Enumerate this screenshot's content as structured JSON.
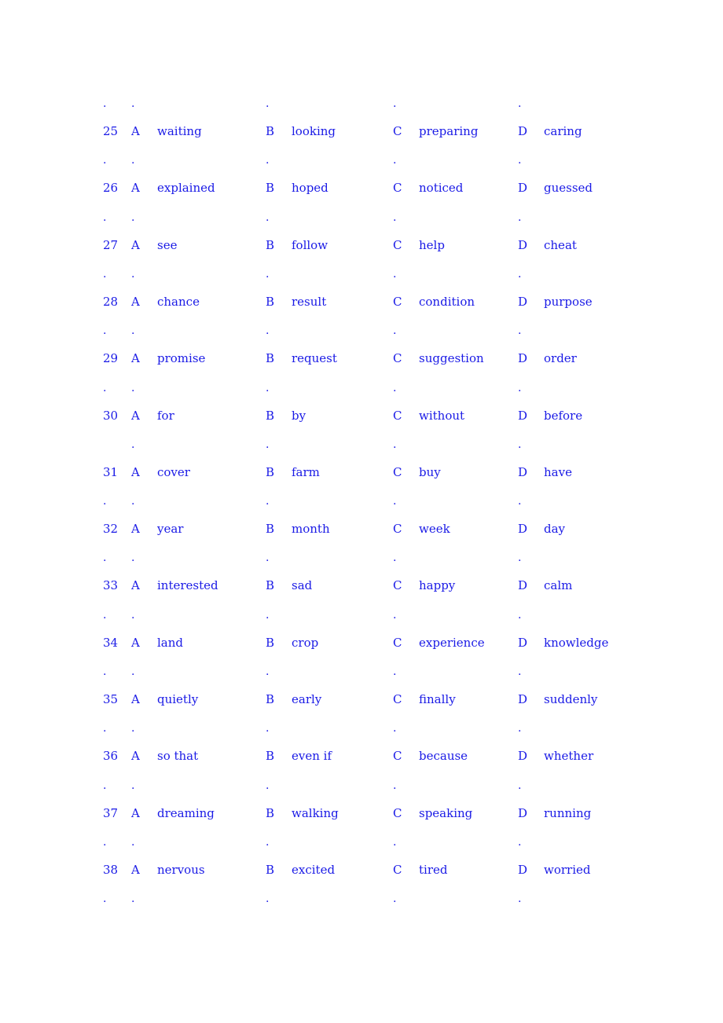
{
  "color": "#1a1ae6",
  "dot": ".",
  "questions": [
    {
      "num": "25",
      "A": "waiting",
      "B": "looking",
      "C": "preparing",
      "D": "caring",
      "leading_dot": true
    },
    {
      "num": "26",
      "A": "explained",
      "B": "hoped",
      "C": "noticed",
      "D": "guessed",
      "leading_dot": true
    },
    {
      "num": "27",
      "A": "see",
      "B": "follow",
      "C": "help",
      "D": "cheat",
      "leading_dot": true
    },
    {
      "num": "28",
      "A": "chance",
      "B": "result",
      "C": "condition",
      "D": "purpose",
      "leading_dot": true
    },
    {
      "num": "29",
      "A": "promise",
      "B": "request",
      "C": "suggestion",
      "D": "order",
      "leading_dot": true
    },
    {
      "num": "30",
      "A": "for",
      "B": "by",
      "C": "without",
      "D": "before",
      "leading_dot": true
    },
    {
      "num": "31",
      "A": "cover",
      "B": "farm",
      "C": "buy",
      "D": "have",
      "leading_dot": false
    },
    {
      "num": "32",
      "A": "year",
      "B": "month",
      "C": "week",
      "D": "day",
      "leading_dot": true
    },
    {
      "num": "33",
      "A": "interested",
      "B": "sad",
      "C": "happy",
      "D": "calm",
      "leading_dot": true
    },
    {
      "num": "34",
      "A": "land",
      "B": "crop",
      "C": "experience",
      "D": "knowledge",
      "leading_dot": true
    },
    {
      "num": "35",
      "A": "quietly",
      "B": "early",
      "C": "finally",
      "D": "suddenly",
      "leading_dot": true
    },
    {
      "num": "36",
      "A": "so that",
      "B": "even if",
      "C": "because",
      "D": "whether",
      "leading_dot": true
    },
    {
      "num": "37",
      "A": "dreaming",
      "B": "walking",
      "C": "speaking",
      "D": "running",
      "leading_dot": true
    },
    {
      "num": "38",
      "A": "nervous",
      "B": "excited",
      "C": "tired",
      "D": "worried",
      "leading_dot": true
    }
  ],
  "labels": {
    "A": "A",
    "B": "B",
    "C": "C",
    "D": "D"
  }
}
